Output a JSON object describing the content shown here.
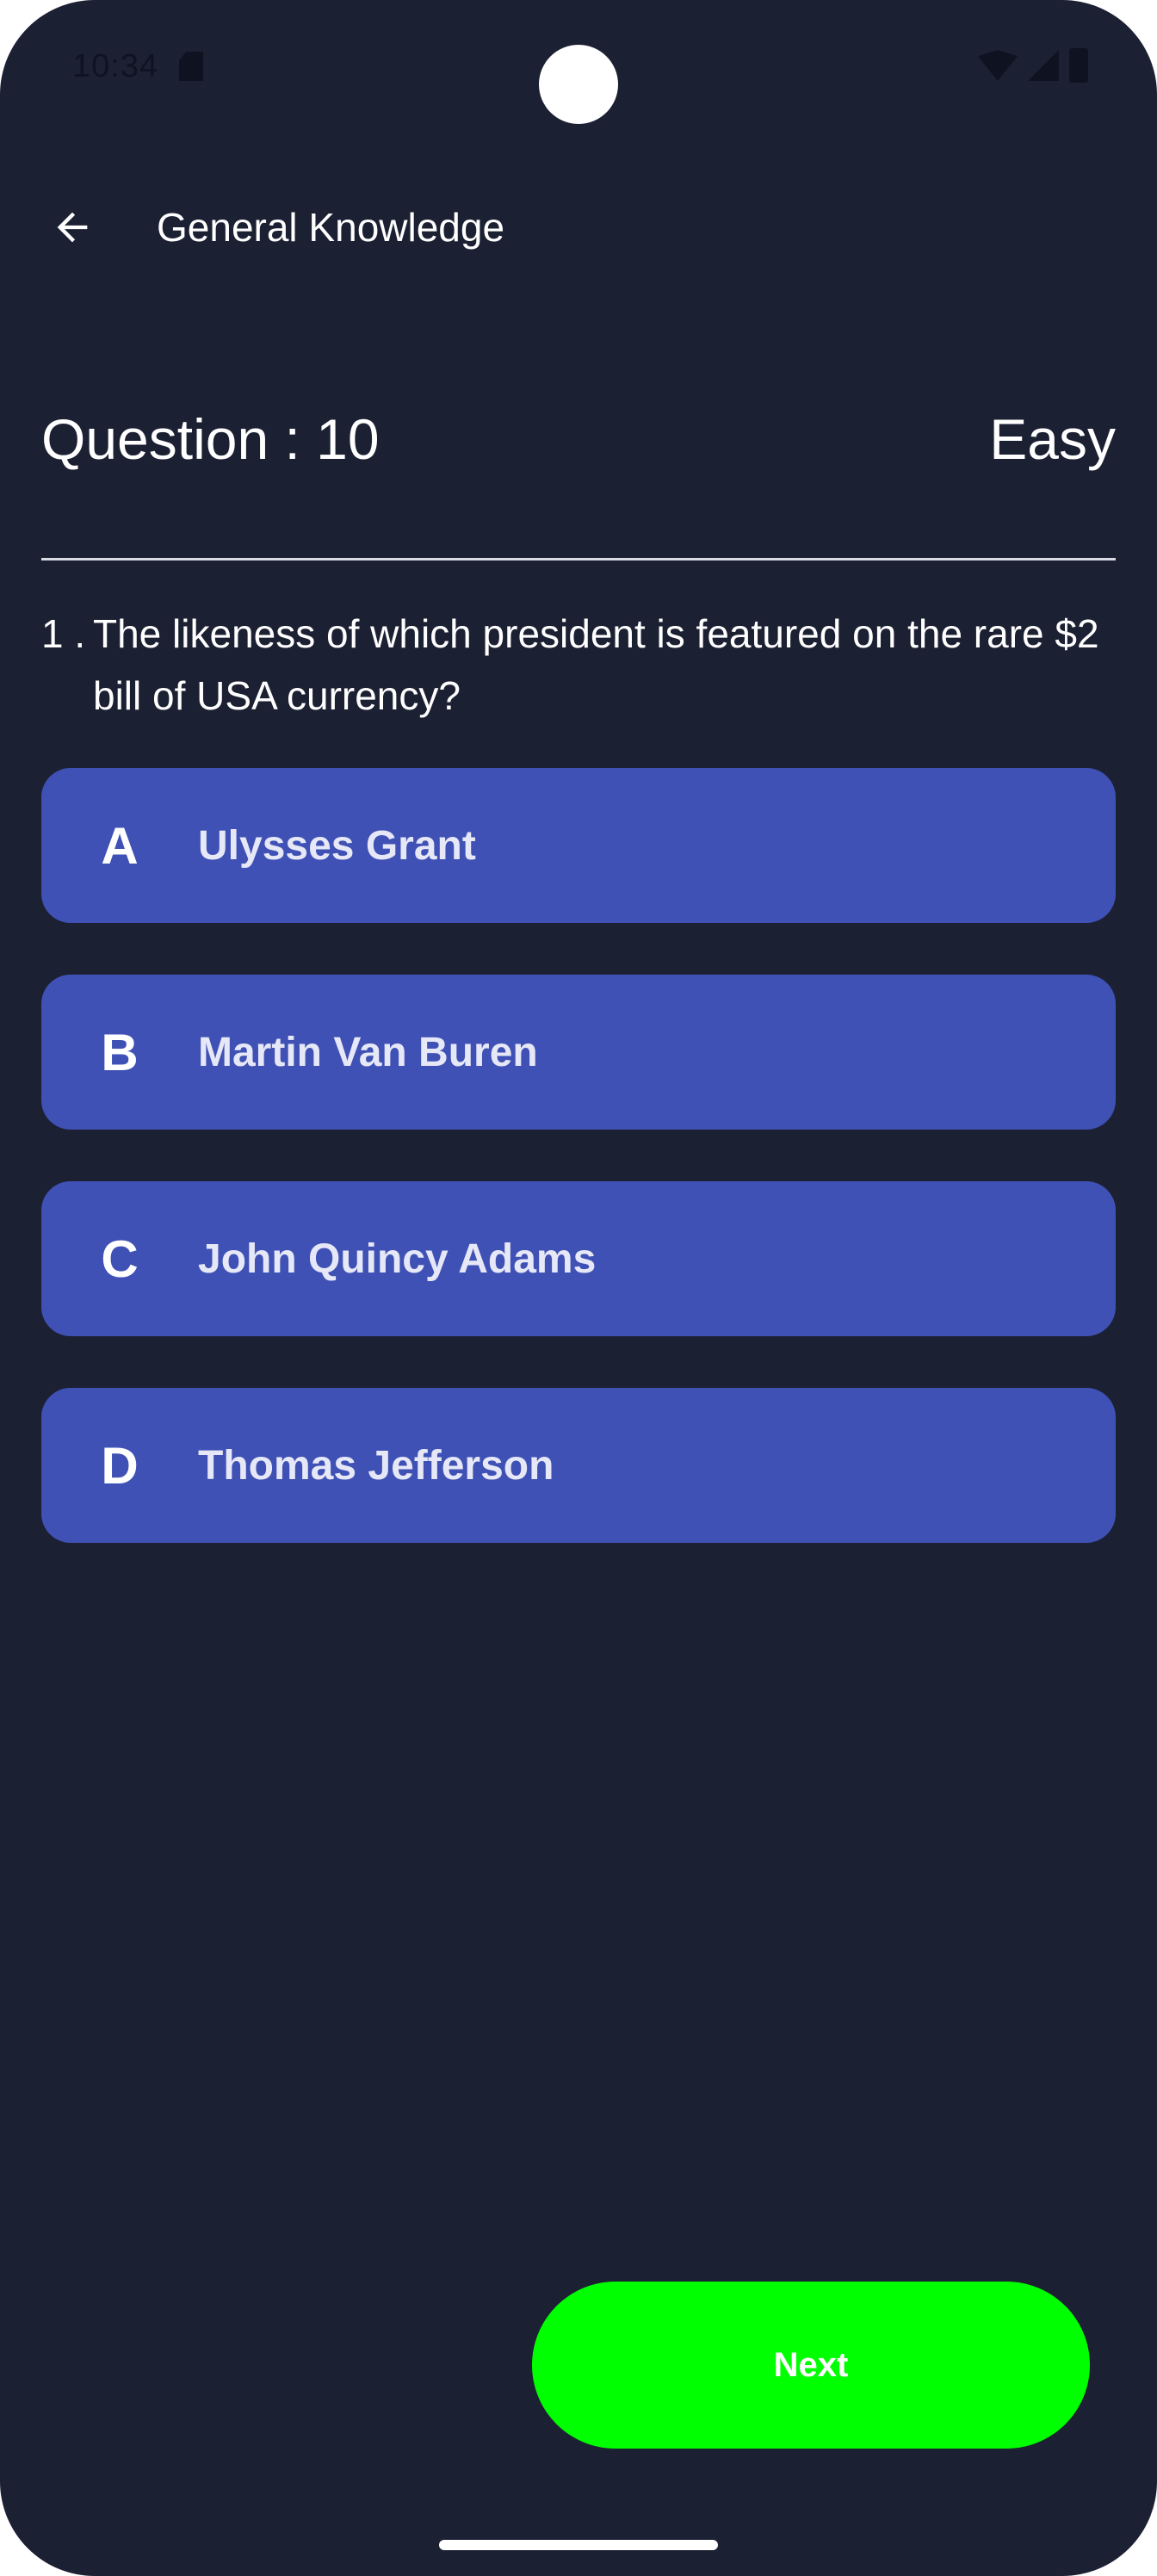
{
  "status_bar": {
    "time": "10:34",
    "icons": [
      "sd-card-icon",
      "wifi-icon",
      "signal-icon",
      "battery-icon"
    ]
  },
  "app_bar": {
    "back_icon": "arrow-left-icon",
    "title": "General Knowledge"
  },
  "quiz": {
    "counter": "Question : 10",
    "difficulty": "Easy",
    "question_number": "1 .",
    "question": "The likeness of which president is featured on the rare $2 bill of USA currency?",
    "options": [
      {
        "letter": "A",
        "text": "Ulysses Grant"
      },
      {
        "letter": "B",
        "text": "Martin Van Buren"
      },
      {
        "letter": "C",
        "text": "John Quincy Adams"
      },
      {
        "letter": "D",
        "text": "Thomas Jefferson"
      }
    ],
    "next_label": "Next"
  },
  "colors": {
    "background": "#1c2033",
    "option_background": "#3f51b5",
    "next_button": "#00ff00",
    "text": "#ffffff"
  }
}
